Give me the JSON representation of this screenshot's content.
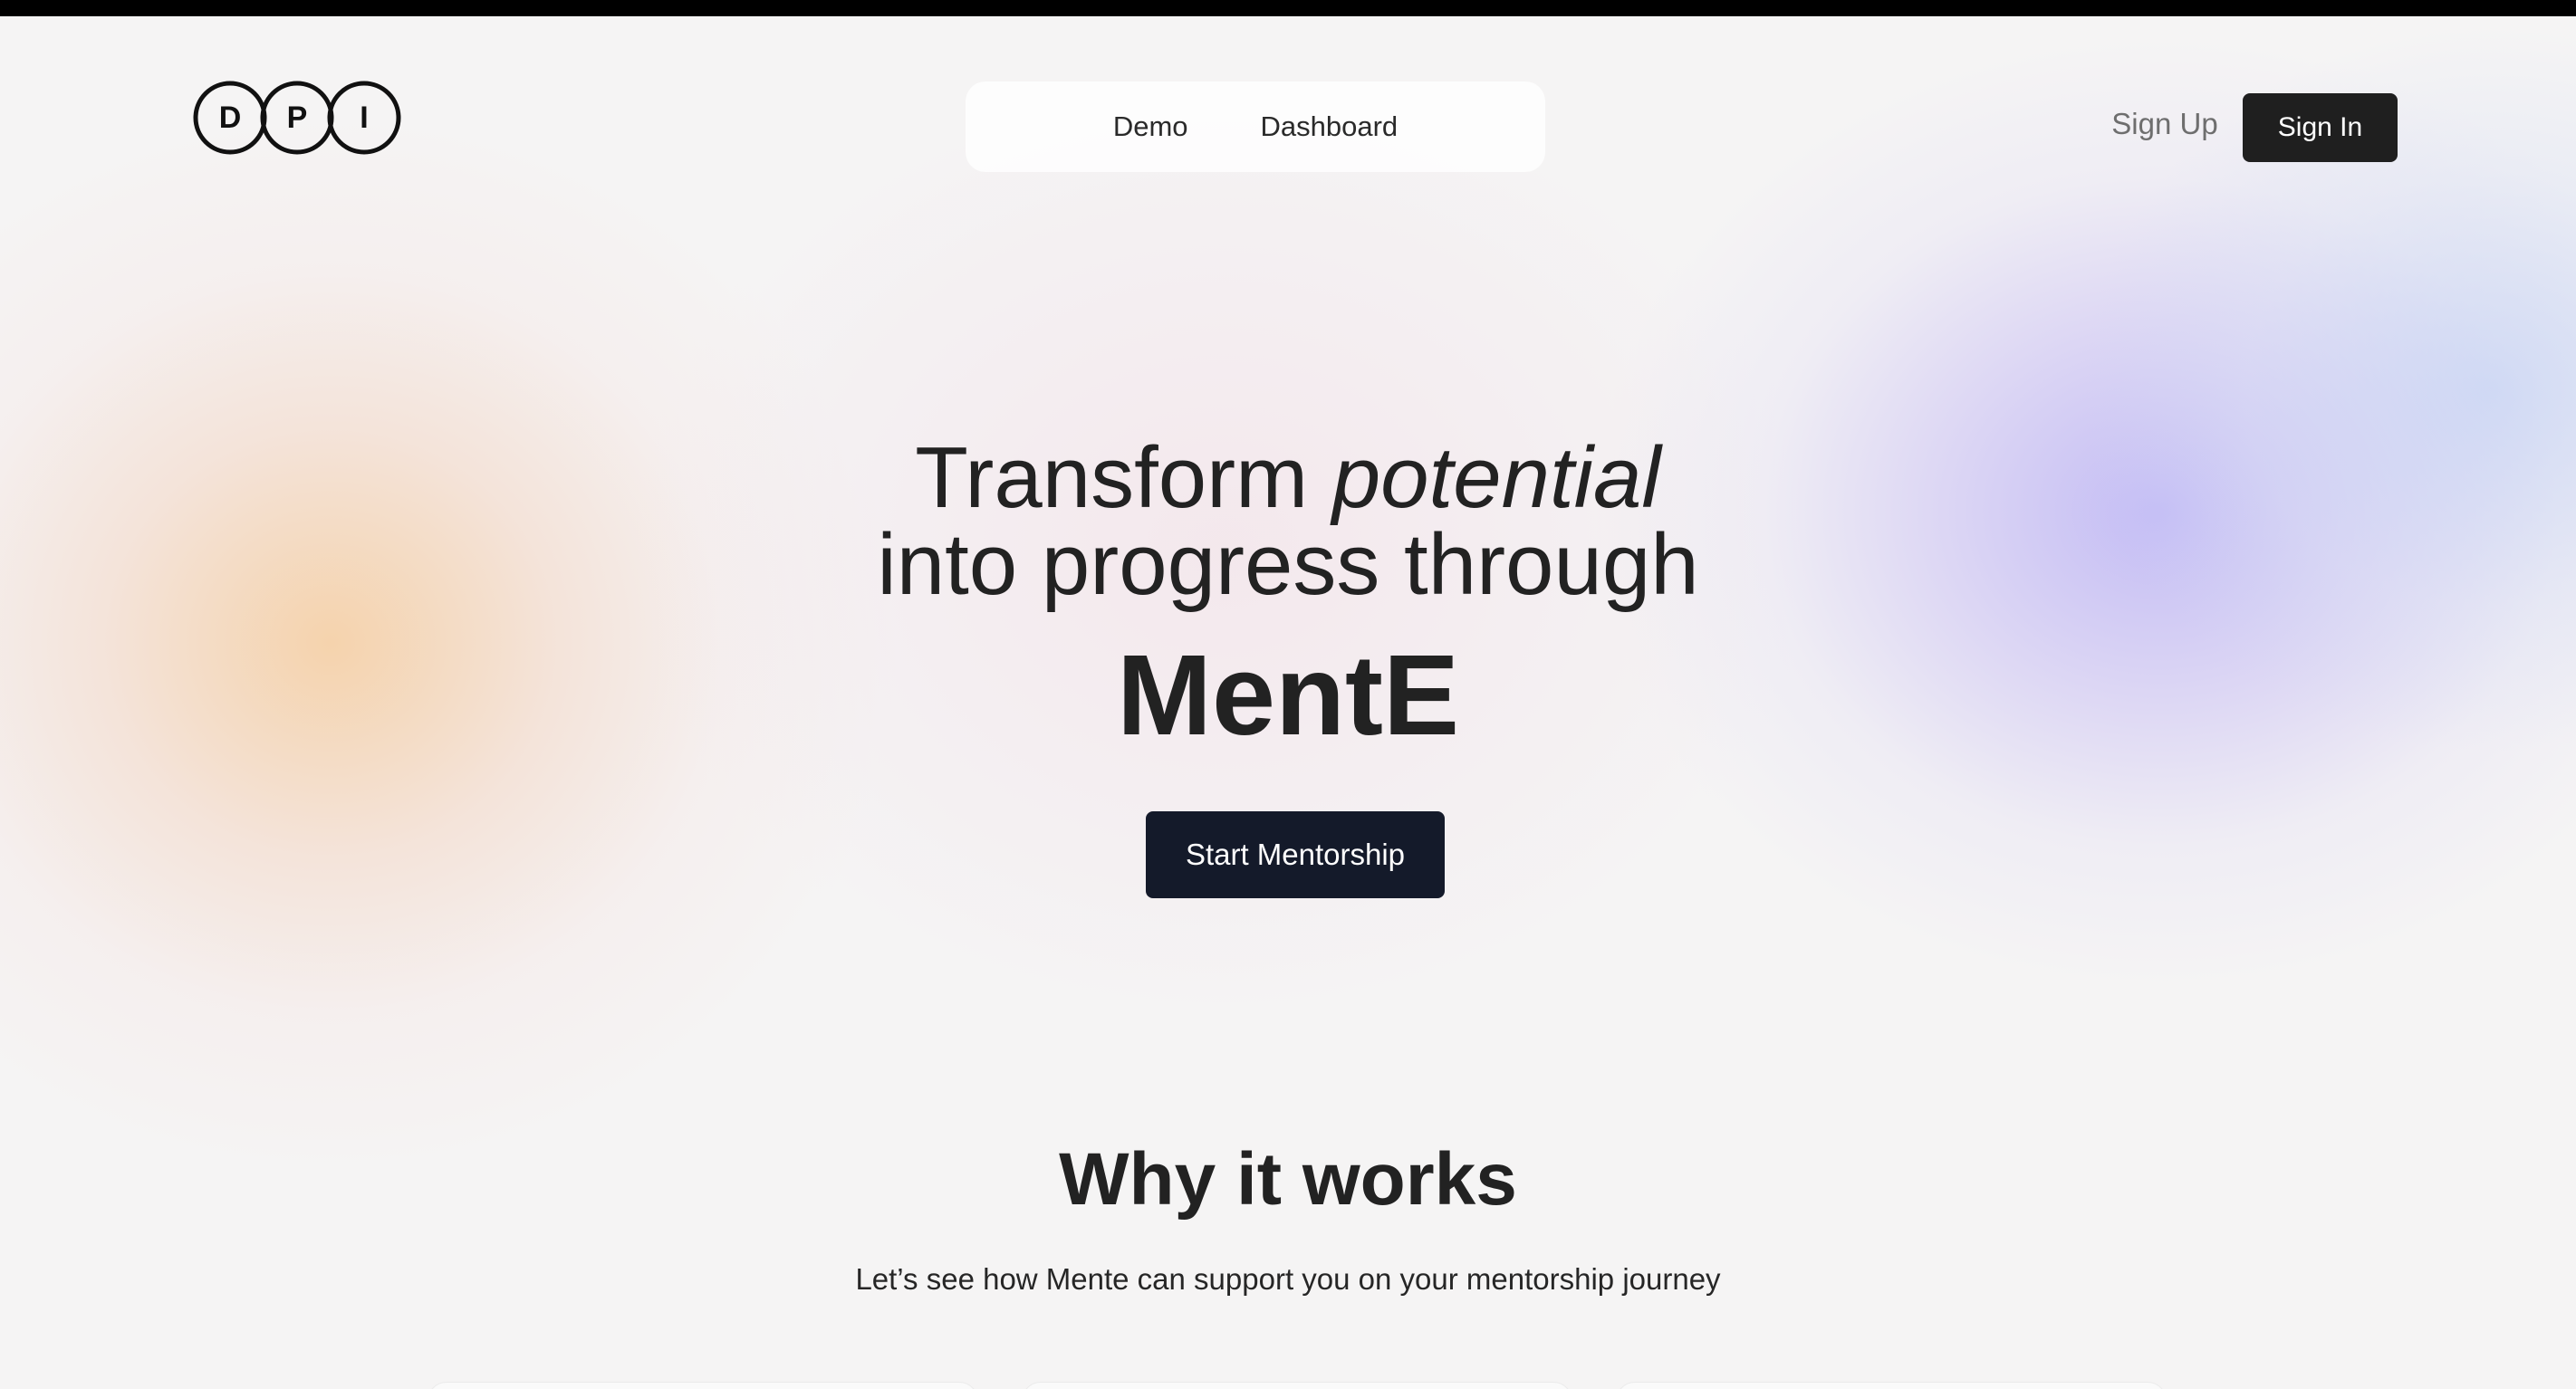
{
  "brand": {
    "logo_letters": [
      "D",
      "P",
      "I"
    ],
    "logo_icon": "dpi-logo"
  },
  "nav": {
    "links": [
      {
        "label": "Demo"
      },
      {
        "label": "Dashboard"
      }
    ],
    "sign_up_label": "Sign Up",
    "sign_in_label": "Sign In"
  },
  "hero": {
    "line1_prefix": "Transform",
    "line1_emphasis": "potential",
    "line2": "into progress through",
    "product_name": "MentE",
    "cta_label": "Start Mentorship"
  },
  "why": {
    "title": "Why it works",
    "subtitle": "Let’s see how Mente can support you on your mentorship journey",
    "cards": [
      {},
      {},
      {}
    ]
  },
  "colors": {
    "background": "#f5f4f4",
    "primary_button": "#1f1f1f",
    "cta_button": "#141a2a",
    "accent_orange": "#f5cda0",
    "accent_purple": "#beb6f5",
    "accent_blue": "#c4d2f4"
  }
}
